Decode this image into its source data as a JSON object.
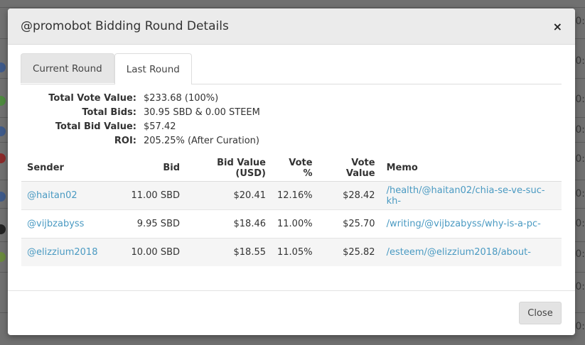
{
  "background": {
    "timestamps": [
      "0:",
      "0:",
      "0:",
      "0:",
      "0:",
      "0:",
      "0:",
      "0:",
      "0:",
      "0:"
    ]
  },
  "modal": {
    "title": "@promobot Bidding Round Details",
    "close_glyph": "×",
    "tabs": [
      {
        "label": "Current Round",
        "active": false
      },
      {
        "label": "Last Round",
        "active": true
      }
    ],
    "summary": [
      {
        "label": "Total Vote Value:",
        "value": "$233.68 (100%)"
      },
      {
        "label": "Total Bids:",
        "value": "30.95 SBD & 0.00 STEEM"
      },
      {
        "label": "Total Bid Value:",
        "value": "$57.42"
      },
      {
        "label": "ROI:",
        "value": "205.25% (After Curation)"
      }
    ],
    "table": {
      "headers": [
        "Sender",
        "Bid",
        "Bid Value (USD)",
        "Vote %",
        "Vote Value",
        "Memo"
      ],
      "rows": [
        {
          "sender": "@haitan02",
          "bid": "11.00 SBD",
          "bid_value": "$20.41",
          "vote_pct": "12.16%",
          "vote_value": "$28.42",
          "memo": "/health/@haitan02/chia-se-ve-suc-kh-"
        },
        {
          "sender": "@vijbzabyss",
          "bid": "9.95 SBD",
          "bid_value": "$18.46",
          "vote_pct": "11.00%",
          "vote_value": "$25.70",
          "memo": "/writing/@vijbzabyss/why-is-a-pc-"
        },
        {
          "sender": "@elizzium2018",
          "bid": "10.00 SBD",
          "bid_value": "$18.55",
          "vote_pct": "11.05%",
          "vote_value": "$25.82",
          "memo": "/esteem/@elizzium2018/about-"
        }
      ]
    },
    "footer": {
      "close_label": "Close"
    }
  },
  "colors": {
    "link": "#4a9ac2",
    "header_bg": "#ebebeb",
    "overlay": "#707070"
  }
}
